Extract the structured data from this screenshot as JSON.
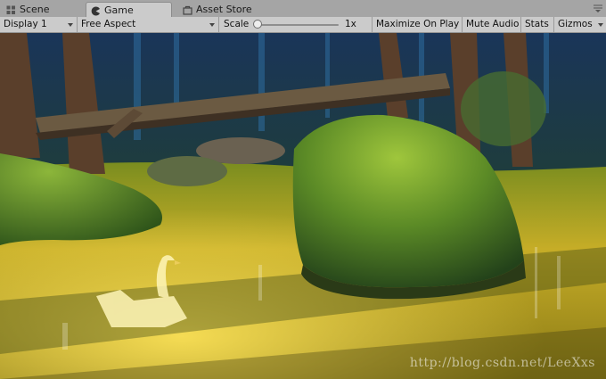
{
  "tabs": [
    {
      "label": "Scene",
      "icon": "scene-grid-icon",
      "active": false
    },
    {
      "label": "Game",
      "icon": "game-pacman-icon",
      "active": true
    },
    {
      "label": "Asset Store",
      "icon": "asset-store-icon",
      "active": false
    }
  ],
  "toolbar": {
    "display": "Display 1",
    "aspect": "Free Aspect",
    "scale_label": "Scale",
    "scale_value": "1x",
    "scale_fraction": 0.0,
    "maximize": "Maximize On Play",
    "mute": "Mute Audio",
    "stats": "Stats",
    "gizmos": "Gizmos"
  },
  "watermark": "http://blog.csdn.net/LeeXxs",
  "colors": {
    "tab_bar": "#a5a5a5",
    "toolbar": "#cbcbcb",
    "forest_dark": "#1d3b2a",
    "grass_yellow": "#d8b72a",
    "moss_green": "#4c7a23"
  }
}
